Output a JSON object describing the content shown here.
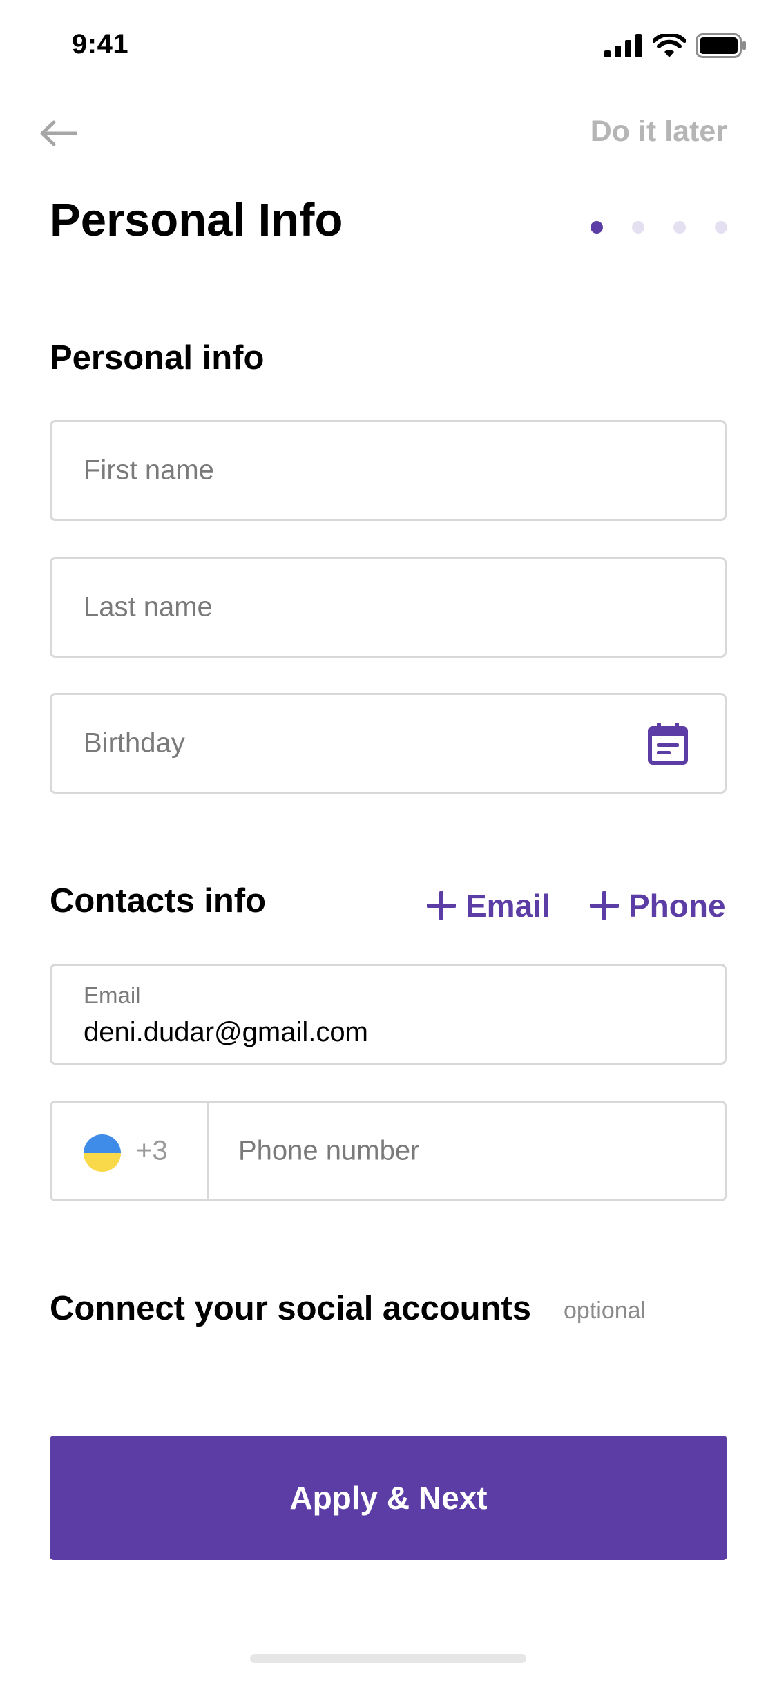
{
  "status_bar": {
    "time": "9:41",
    "icons": [
      "signal-icon",
      "wifi-icon",
      "battery-icon"
    ]
  },
  "nav": {
    "back_icon": "arrow-left-icon",
    "skip_label": "Do it later"
  },
  "header": {
    "title": "Personal Info",
    "steps": {
      "total": 4,
      "current": 1
    }
  },
  "personal": {
    "heading": "Personal info",
    "first_name_placeholder": "First name",
    "last_name_placeholder": "Last name",
    "birthday_placeholder": "Birthday",
    "birthday_icon": "calendar-icon"
  },
  "contacts": {
    "heading": "Contacts info",
    "add_email_label": "Email",
    "add_phone_label": "Phone",
    "email_label": "Email",
    "email_value": "deni.dudar@gmail.com",
    "dial_code": "+3",
    "phone_placeholder": "Phone number"
  },
  "social": {
    "heading": "Connect your social accounts",
    "optional_label": "optional"
  },
  "actions": {
    "primary_label": "Apply & Next"
  },
  "colors": {
    "accent": "#5b3da5",
    "muted": "#b5b5b5",
    "border": "#d8d8d8",
    "flag_top": "#3e8be8",
    "flag_bottom": "#f9d84a"
  }
}
